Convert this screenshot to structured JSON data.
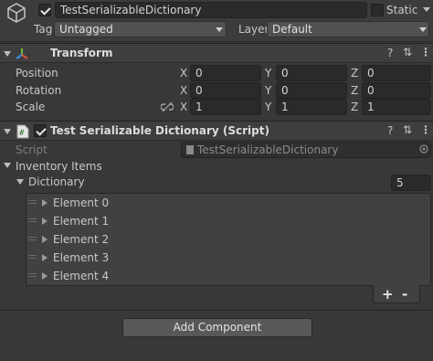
{
  "gameobject": {
    "name": "TestSerializableDictionary",
    "static_label": "Static",
    "tag_label": "Tag",
    "tag_value": "Untagged",
    "layer_label": "Layer",
    "layer_value": "Default"
  },
  "transform": {
    "title": "Transform",
    "rows": [
      {
        "label": "Position",
        "x": "0",
        "y": "0",
        "z": "0"
      },
      {
        "label": "Rotation",
        "x": "0",
        "y": "0",
        "z": "0"
      },
      {
        "label": "Scale",
        "x": "1",
        "y": "1",
        "z": "1"
      }
    ],
    "axis_x": "X",
    "axis_y": "Y",
    "axis_z": "Z"
  },
  "script_component": {
    "title": "Test Serializable Dictionary (Script)",
    "script_label": "Script",
    "script_value": "TestSerializableDictionary",
    "inventory_label": "Inventory Items",
    "dictionary_label": "Dictionary",
    "dictionary_size": "5",
    "elements": [
      "Element 0",
      "Element 1",
      "Element 2",
      "Element 3",
      "Element 4"
    ],
    "plus": "+",
    "minus": "-"
  },
  "add_component": "Add Component",
  "icons": {
    "header_icons": [
      "help-icon",
      "preset-icon",
      "more-icon"
    ]
  }
}
